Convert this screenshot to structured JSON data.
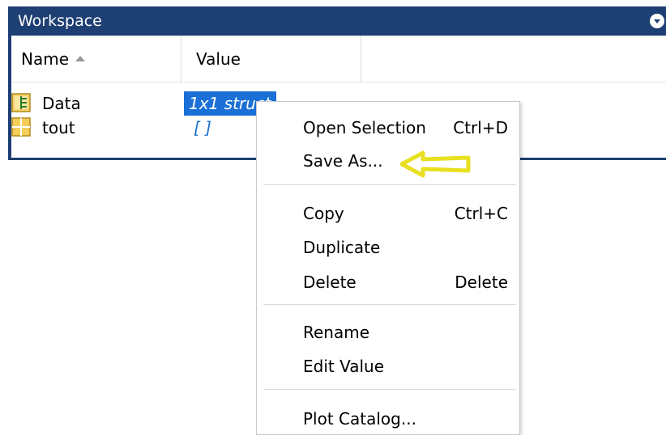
{
  "panel": {
    "title": "Workspace",
    "menu_icon": "chevron-down-circle-icon",
    "accent_color": "#1e3f73"
  },
  "table": {
    "columns": [
      {
        "label": "Name",
        "sort": "ascending"
      },
      {
        "label": "Value"
      }
    ],
    "rows": [
      {
        "icon": "struct-icon",
        "name": "Data",
        "value": "1x1 struct",
        "selected": true
      },
      {
        "icon": "matrix-icon",
        "name": "tout",
        "value": "[ ]",
        "selected": false
      }
    ]
  },
  "context_menu": {
    "items": [
      {
        "label": "Open Selection",
        "shortcut": "Ctrl+D"
      },
      {
        "label": "Save As...",
        "shortcut": ""
      },
      {
        "label": "Copy",
        "shortcut": "Ctrl+C"
      },
      {
        "label": "Duplicate",
        "shortcut": ""
      },
      {
        "label": "Delete",
        "shortcut": "Delete"
      },
      {
        "label": "Rename",
        "shortcut": ""
      },
      {
        "label": "Edit Value",
        "shortcut": ""
      },
      {
        "label": "Plot Catalog...",
        "shortcut": ""
      }
    ]
  },
  "annotation": {
    "icon": "left-arrow-icon",
    "color": "#e8e020"
  }
}
